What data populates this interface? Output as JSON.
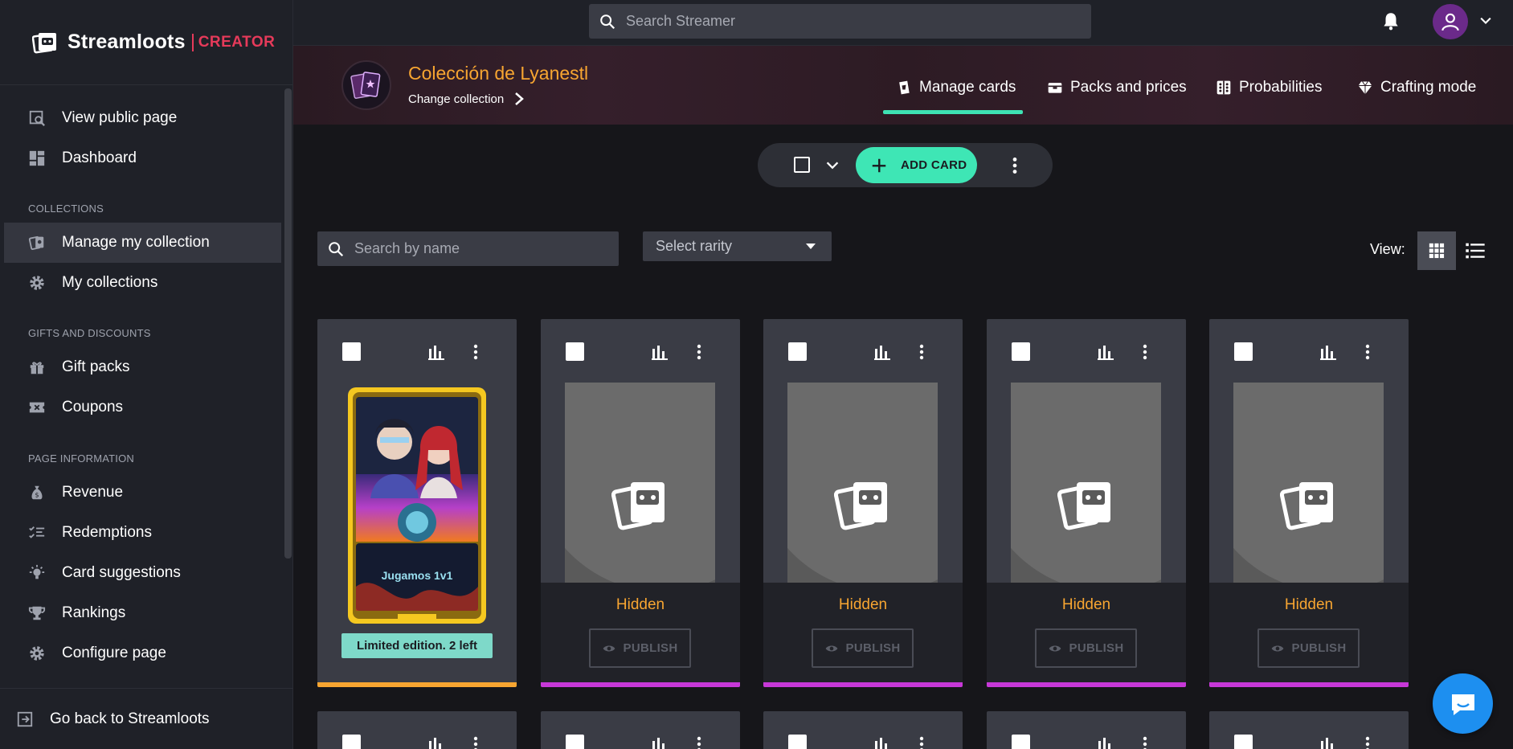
{
  "brand": {
    "name": "Streamloots",
    "creator": "CREATOR",
    "accent": "#e63a5a"
  },
  "search": {
    "streamer_placeholder": "Search Streamer"
  },
  "sidebar": {
    "items": [
      {
        "label": "View public page",
        "icon": "view-page-icon"
      },
      {
        "label": "Dashboard",
        "icon": "dashboard-icon"
      },
      {
        "label": "Manage my collection",
        "icon": "cards-icon",
        "active": true
      },
      {
        "label": "My collections",
        "icon": "gear-icon"
      },
      {
        "label": "Gift packs",
        "icon": "gift-icon"
      },
      {
        "label": "Coupons",
        "icon": "coupon-icon"
      },
      {
        "label": "Revenue",
        "icon": "money-bag-icon"
      },
      {
        "label": "Redemptions",
        "icon": "checklist-icon"
      },
      {
        "label": "Card suggestions",
        "icon": "lightbulb-icon"
      },
      {
        "label": "Rankings",
        "icon": "trophy-icon"
      },
      {
        "label": "Configure page",
        "icon": "gear-icon"
      }
    ],
    "sections": {
      "collections": "COLLECTIONS",
      "gifts": "GIFTS AND DISCOUNTS",
      "page_info": "PAGE INFORMATION"
    },
    "back": "Go back to Streamloots"
  },
  "collection": {
    "title": "Colección de Lyanestl",
    "change": "Change collection"
  },
  "tabs": [
    {
      "label": "Manage cards",
      "icon": "manage-cards-icon",
      "active": true
    },
    {
      "label": "Packs and prices",
      "icon": "packs-icon"
    },
    {
      "label": "Probabilities",
      "icon": "dice-icon"
    },
    {
      "label": "Crafting mode",
      "icon": "diamond-icon"
    }
  ],
  "actions": {
    "add_card": "ADD CARD"
  },
  "filters": {
    "search_placeholder": "Search by name",
    "rarity": "Select rarity",
    "view_label": "View:"
  },
  "cards": [
    {
      "art_text": "Jugamos 1v1",
      "badge": "Limited edition. 2 left",
      "bar_color": "#f7a531"
    },
    {
      "status": "Hidden",
      "publish": "PUBLISH",
      "bar_color": "#c738d8"
    },
    {
      "status": "Hidden",
      "publish": "PUBLISH",
      "bar_color": "#c738d8"
    },
    {
      "status": "Hidden",
      "publish": "PUBLISH",
      "bar_color": "#c738d8"
    },
    {
      "status": "Hidden",
      "publish": "PUBLISH",
      "bar_color": "#c738d8"
    }
  ],
  "colors": {
    "teal": "#3ee6b5",
    "orange": "#f7a531",
    "purple": "#c738d8",
    "chat": "#1d8ff0"
  }
}
